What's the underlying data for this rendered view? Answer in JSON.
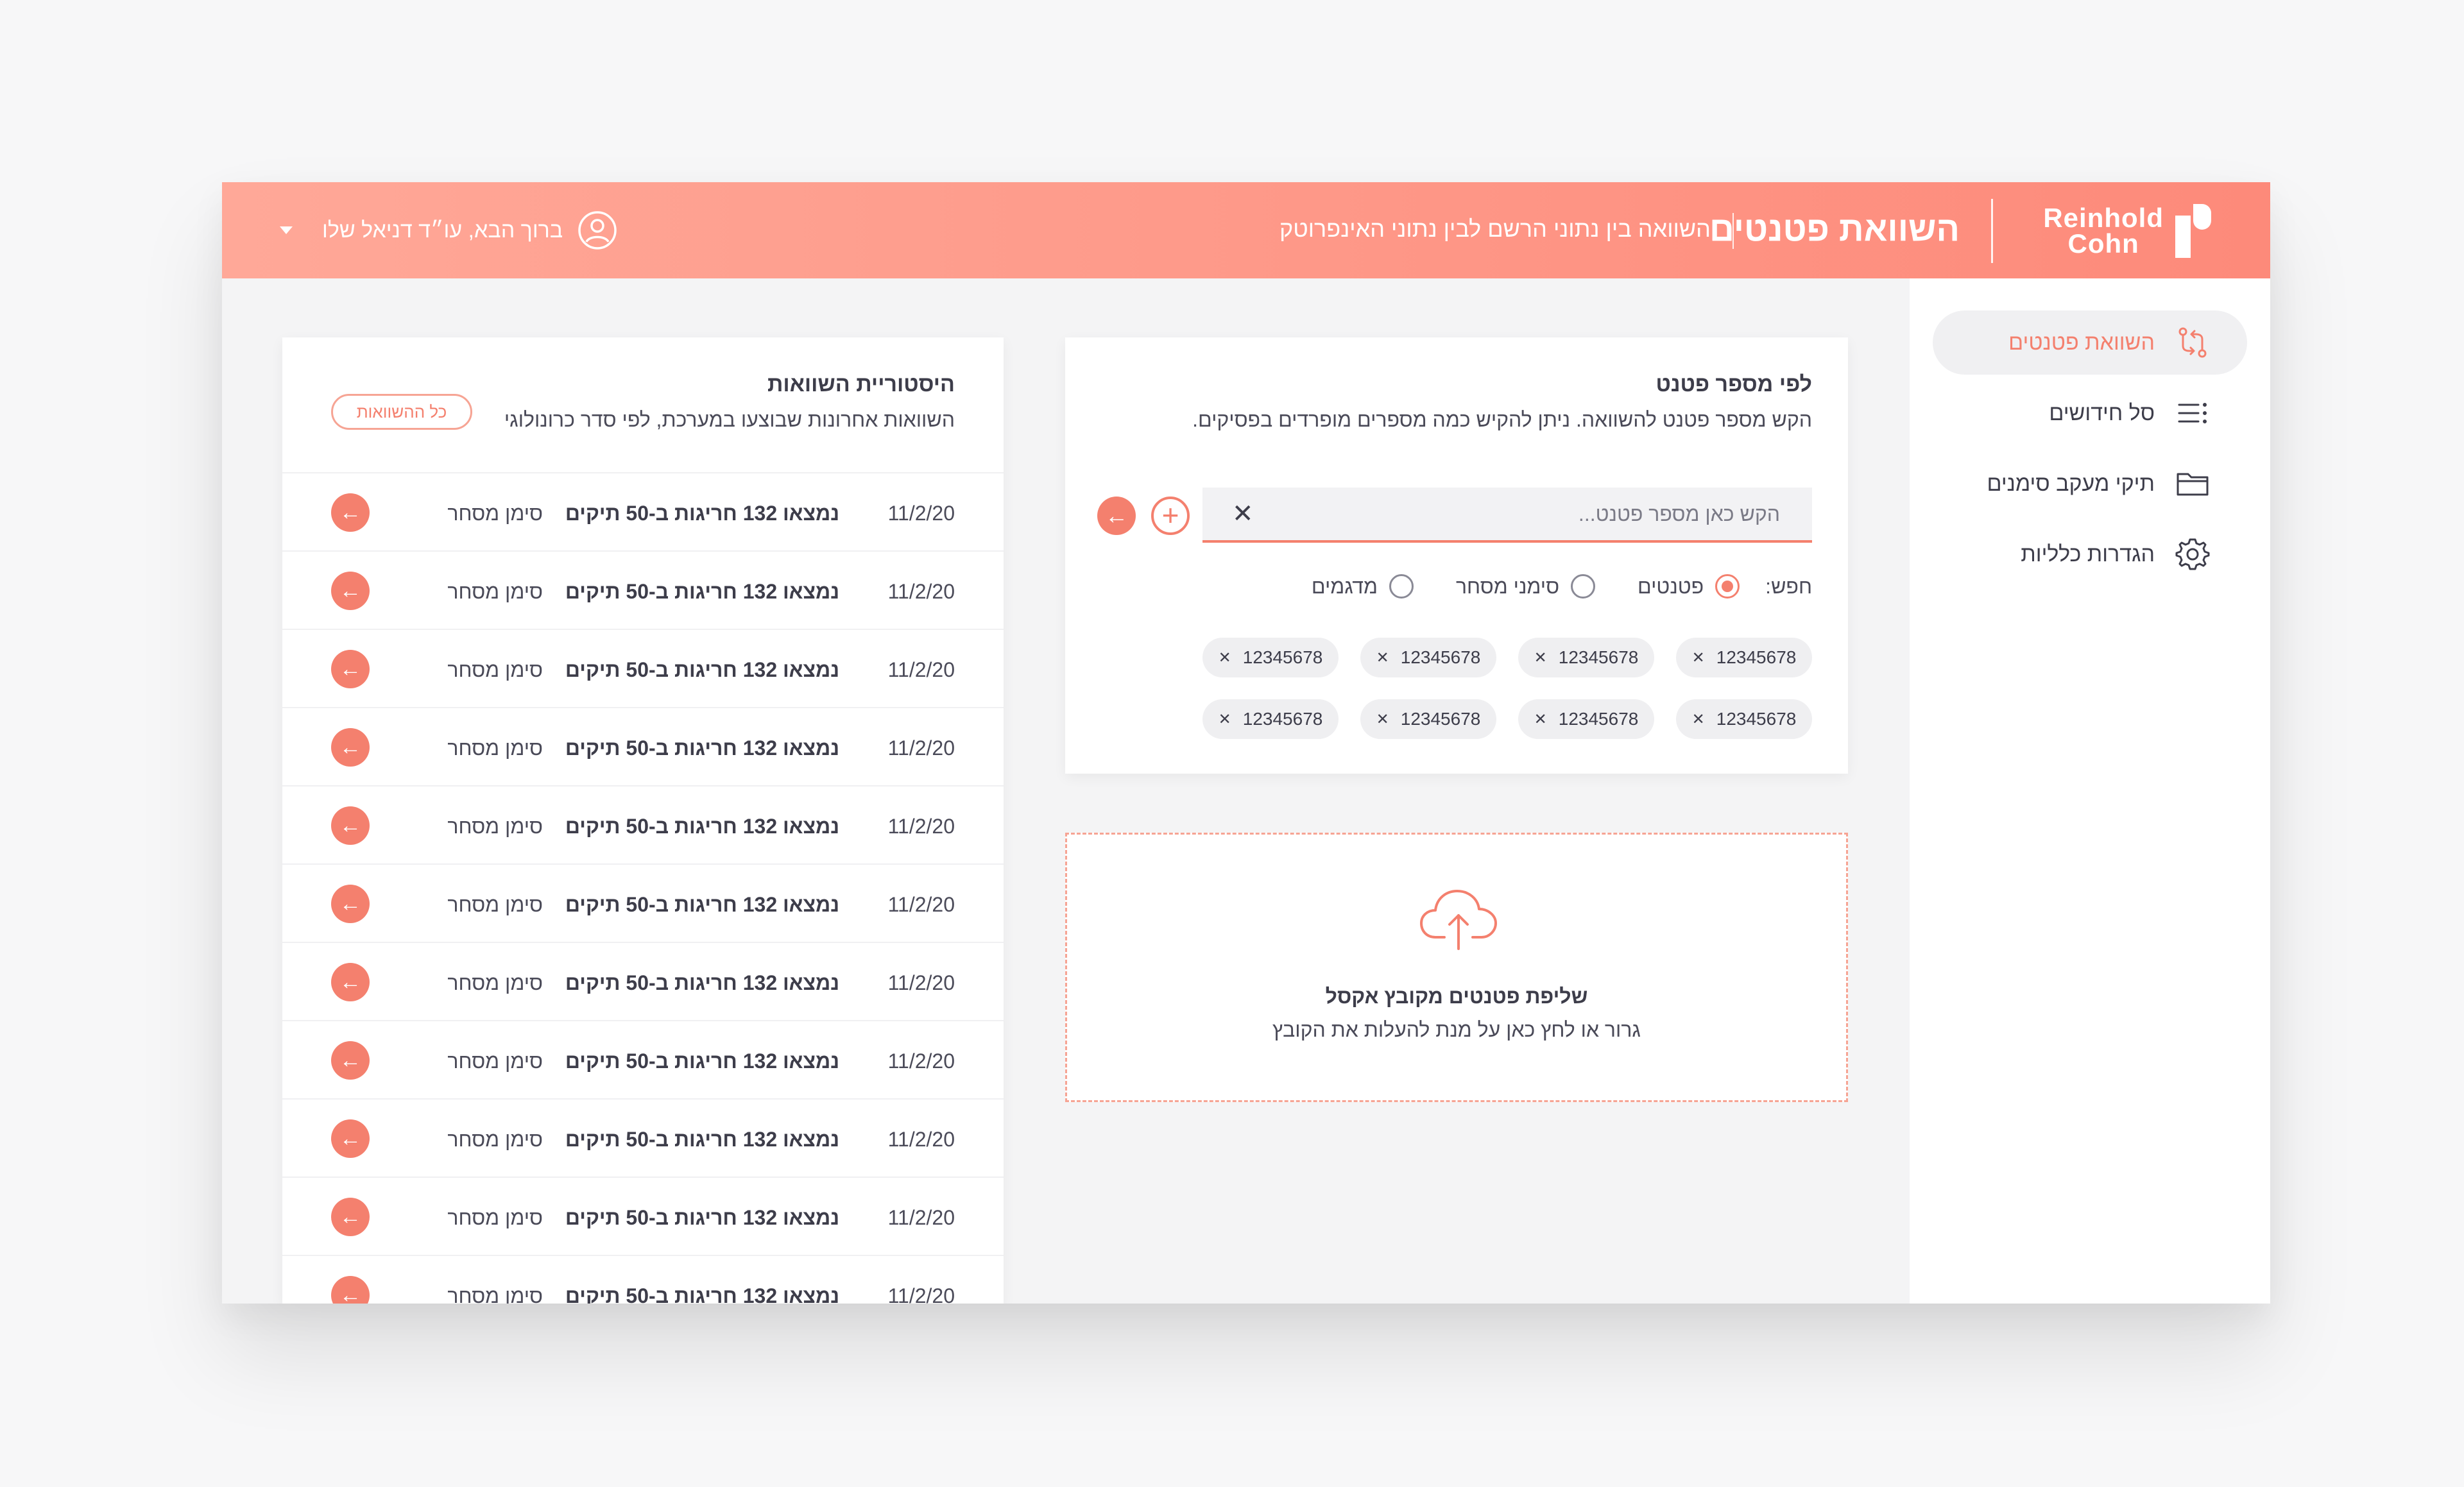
{
  "header": {
    "logo_text": "Reinhold Cohn",
    "logo_line1": "Reinhold",
    "logo_line2": "Cohn",
    "title": "השוואת פטנטים",
    "subtitle": "השוואה בין נתוני הרשם לבין נתוני האינפרוטק",
    "user_greeting": "ברוך הבא, עו״ד דניאל שלו"
  },
  "sidebar": {
    "items": [
      {
        "label": "השוואת פטנטים",
        "icon": "compare-arrows-icon",
        "active": true
      },
      {
        "label": "סל חידושים",
        "icon": "list-icon",
        "active": false
      },
      {
        "label": "תיקי מעקב סימנים",
        "icon": "folder-icon",
        "active": false
      },
      {
        "label": "הגדרות כלליות",
        "icon": "gear-icon",
        "active": false
      }
    ]
  },
  "search_panel": {
    "title": "לפי מספר פטנט",
    "description": "הקש מספר פטנט להשוואה. ניתן להקיש כמה מספרים מופרדים בפסיקים.",
    "input_placeholder": "הקש כאן מספר פטנט...",
    "input_value": "",
    "clear_label": "✕",
    "add_label": "+",
    "go_label": "←",
    "search_label": "חפש:",
    "radios": [
      {
        "label": "פטנטים",
        "checked": true
      },
      {
        "label": "סימני מסחר",
        "checked": false
      },
      {
        "label": "מדגמים",
        "checked": false
      }
    ],
    "chips": [
      "12345678",
      "12345678",
      "12345678",
      "12345678",
      "12345678",
      "12345678",
      "12345678",
      "12345678"
    ]
  },
  "upload_panel": {
    "icon": "cloud-upload-icon",
    "title": "שליפת פטנטים מקובץ אקסל",
    "subtitle": "גרור או לחץ כאן על מנת להעלות את הקובץ"
  },
  "history_panel": {
    "title": "היסטוריית השוואות",
    "description": "השוואות אחרונות שבוצעו במערכת, לפי סדר כרונולוגי",
    "all_button": "כל ההשוואות",
    "rows": [
      {
        "date": "11/2/20",
        "description": "נמצאו 132 חריגות ב-50 תיקים",
        "type": "סימן מסחר"
      },
      {
        "date": "11/2/20",
        "description": "נמצאו 132 חריגות ב-50 תיקים",
        "type": "סימן מסחר"
      },
      {
        "date": "11/2/20",
        "description": "נמצאו 132 חריגות ב-50 תיקים",
        "type": "סימן מסחר"
      },
      {
        "date": "11/2/20",
        "description": "נמצאו 132 חריגות ב-50 תיקים",
        "type": "סימן מסחר"
      },
      {
        "date": "11/2/20",
        "description": "נמצאו 132 חריגות ב-50 תיקים",
        "type": "סימן מסחר"
      },
      {
        "date": "11/2/20",
        "description": "נמצאו 132 חריגות ב-50 תיקים",
        "type": "סימן מסחר"
      },
      {
        "date": "11/2/20",
        "description": "נמצאו 132 חריגות ב-50 תיקים",
        "type": "סימן מסחר"
      },
      {
        "date": "11/2/20",
        "description": "נמצאו 132 חריגות ב-50 תיקים",
        "type": "סימן מסחר"
      },
      {
        "date": "11/2/20",
        "description": "נמצאו 132 חריגות ב-50 תיקים",
        "type": "סימן מסחר"
      },
      {
        "date": "11/2/20",
        "description": "נמצאו 132 חריגות ב-50 תיקים",
        "type": "סימן מסחר"
      },
      {
        "date": "11/2/20",
        "description": "נמצאו 132 חריגות ב-50 תיקים",
        "type": "סימן מסחר"
      }
    ],
    "row_go_label": "←"
  },
  "colors": {
    "accent": "#f4806e",
    "header_start": "#ffa898",
    "header_end": "#fd8a7a",
    "text": "#3d3d4a"
  }
}
